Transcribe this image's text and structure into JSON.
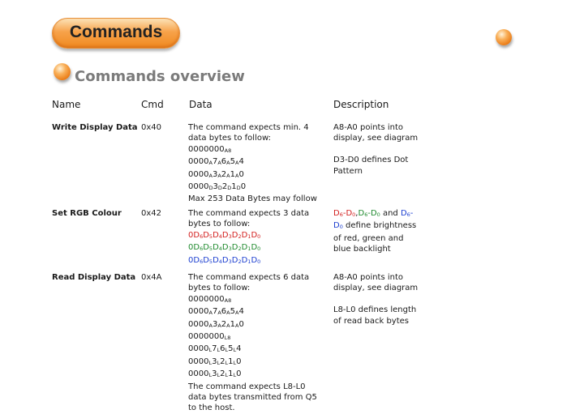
{
  "header": {
    "title": "Commands"
  },
  "section": {
    "title": "Commands overview"
  },
  "table": {
    "columns": [
      "Name",
      "Cmd",
      "Data",
      "Description"
    ],
    "rows": [
      {
        "name": "Write Display Data",
        "cmd": "0x40",
        "data": [
          "The command expects min. 4",
          "data bytes to follow:",
          "0000000A8",
          "0000A7A6A5A4",
          "0000A3A2A1A0",
          "0000D3D2D1D0",
          "Max 253 Data Bytes may follow"
        ],
        "desc": [
          "A8-A0 points into",
          "display, see diagram",
          "",
          "D3-D0 defines Dot",
          "Pattern"
        ]
      },
      {
        "name": "Set RGB Colour",
        "cmd": "0x42",
        "data": [
          "The command expects 3 data",
          "bytes to follow:",
          "0D6D5D4D3D2D1D0",
          "0D6D5D4D3D2D1D0",
          "0D6D5D4D3D2D1D0"
        ],
        "desc": [
          "D6-D0,D6-D0 and D6-",
          "D0 define brightness",
          "of red, green and",
          "blue backlight"
        ]
      },
      {
        "name": "Read Display Data",
        "cmd": "0x4A",
        "data": [
          "The command expects 6 data",
          "bytes to follow:",
          "0000000A8",
          "0000A7A6A5A4",
          "0000A3A2A1A0",
          "0000000L8",
          "0000L7L6L5L4",
          "0000L3L2L1L0",
          "0000L3L2L1L0",
          "The command expects L8-L0",
          "data bytes transmitted from Q5",
          "to the host."
        ],
        "desc": [
          "A8-A0 points into",
          "display, see diagram",
          "",
          "L8-L0 defines length",
          "of read back bytes"
        ]
      }
    ]
  },
  "colors": {
    "red": "#d3201f",
    "green": "#1f8a2e",
    "blue": "#1c3fd0",
    "accent": "#f08a20"
  }
}
